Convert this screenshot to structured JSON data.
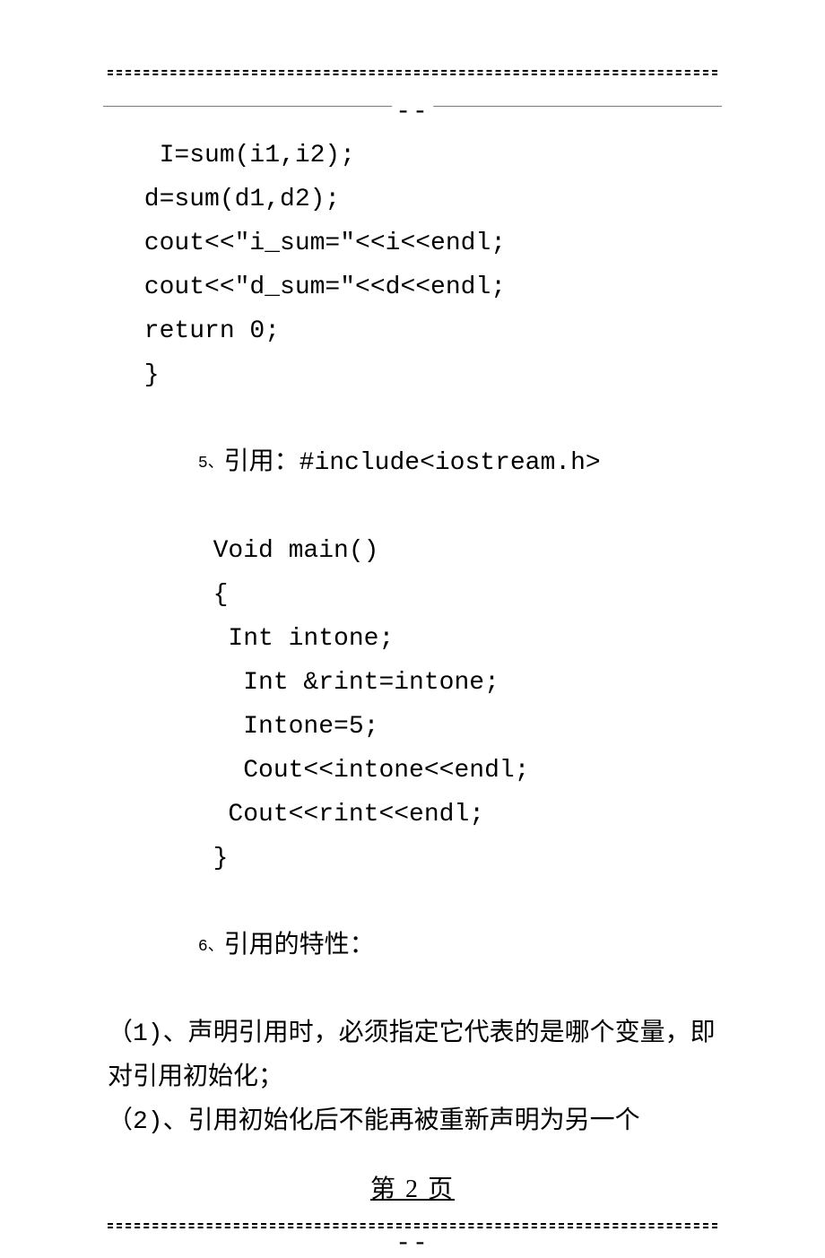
{
  "header": {
    "dash_center": "--"
  },
  "code_block_a": {
    "l1": "  I=sum(i1,i2);",
    "l2": " d=sum(d1,d2);",
    "l3": " cout<<\"i_sum=\"<<i<<endl;",
    "l4": " cout<<\"d_sum=\"<<d<<endl;",
    "l5": " return 0;",
    "l6": " }"
  },
  "item5": {
    "label": "5、",
    "title": "引用：#include<iostream.h>",
    "l1": "       Void main()",
    "l2": "       {",
    "l3": "        Int intone;",
    "l4": "         Int &rint=intone;",
    "l5": "         Intone=5;",
    "l6": "         Cout<<intone<<endl;",
    "l7": "        Cout<<rint<<endl;",
    "l8": "       }"
  },
  "item6": {
    "label": "6、",
    "title": "引用的特性：",
    "p1": "（1)、声明引用时，必须指定它代表的是哪个变量，即对引用初始化；",
    "p2": "（2)、引用初始化后不能再被重新声明为另一个"
  },
  "footer": {
    "page_num": "第 2 页",
    "dash_center": "--"
  }
}
